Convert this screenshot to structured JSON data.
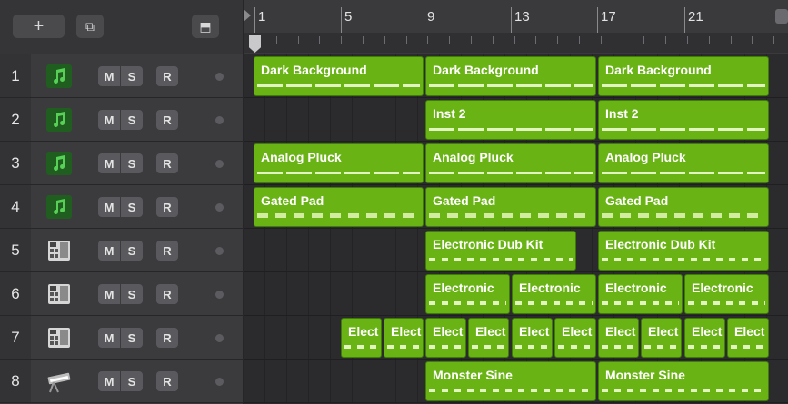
{
  "toolbar": {
    "add_label": "+",
    "dup_label": "⧉",
    "show_label": "⬒"
  },
  "ruler": {
    "bars": [
      "1",
      "5",
      "9",
      "13",
      "17",
      "21"
    ]
  },
  "tracks": [
    {
      "number": "1",
      "icon": "music-note-icon",
      "mute": "M",
      "solo": "S",
      "record": "R"
    },
    {
      "number": "2",
      "icon": "music-note-icon",
      "mute": "M",
      "solo": "S",
      "record": "R"
    },
    {
      "number": "3",
      "icon": "music-note-icon",
      "mute": "M",
      "solo": "S",
      "record": "R"
    },
    {
      "number": "4",
      "icon": "music-note-icon",
      "mute": "M",
      "solo": "S",
      "record": "R"
    },
    {
      "number": "5",
      "icon": "drum-machine-icon",
      "mute": "M",
      "solo": "S",
      "record": "R"
    },
    {
      "number": "6",
      "icon": "drum-machine-icon",
      "mute": "M",
      "solo": "S",
      "record": "R"
    },
    {
      "number": "7",
      "icon": "drum-machine-icon",
      "mute": "M",
      "solo": "S",
      "record": "R"
    },
    {
      "number": "8",
      "icon": "keyboard-synth-icon",
      "mute": "M",
      "solo": "S",
      "record": "R"
    }
  ],
  "regions": {
    "t1": [
      "Dark Background",
      "Dark Background",
      "Dark Background"
    ],
    "t2": [
      "Inst 2",
      "Inst 2"
    ],
    "t3": [
      "Analog Pluck",
      "Analog Pluck",
      "Analog Pluck"
    ],
    "t4": [
      "Gated Pad",
      "Gated Pad",
      "Gated Pad"
    ],
    "t5": [
      "Electronic Dub Kit",
      "Electronic Dub Kit"
    ],
    "t6": [
      "Electronic",
      "Electronic",
      "Electronic",
      "Electronic"
    ],
    "t7": [
      "Elect",
      "Elect",
      "Elect",
      "Elect",
      "Elect",
      "Elect",
      "Elect",
      "Elect",
      "Elect",
      "Elect"
    ],
    "t8": [
      "Monster Sine",
      "Monster Sine"
    ]
  },
  "colors": {
    "region": "#69b314",
    "region_border": "#3e7c08",
    "inst_icon_bg": "#1f5e1f"
  }
}
